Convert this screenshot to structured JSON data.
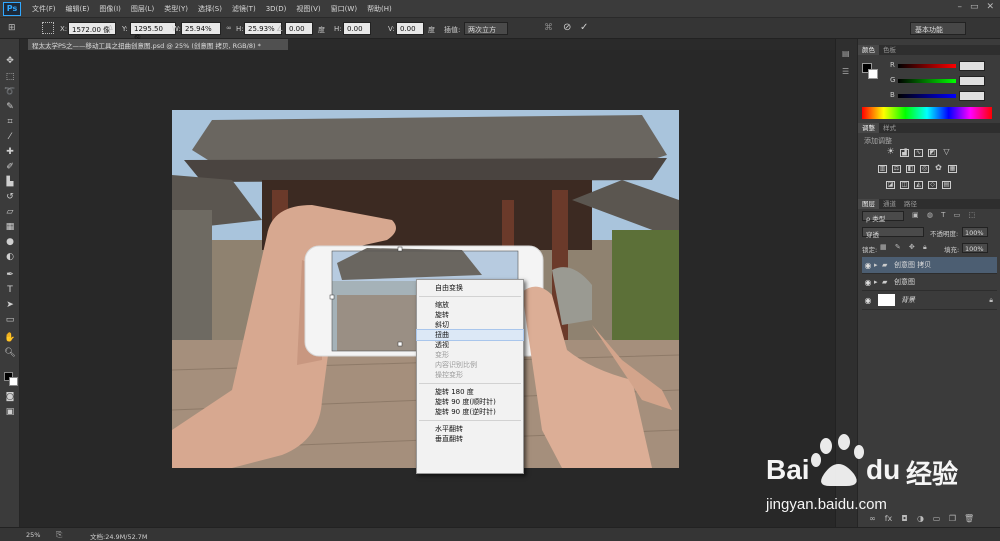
{
  "app": {
    "logo": "Ps",
    "menus": [
      "文件(F)",
      "编辑(E)",
      "图像(I)",
      "图层(L)",
      "类型(Y)",
      "选择(S)",
      "滤镜(T)",
      "3D(D)",
      "视图(V)",
      "窗口(W)",
      "帮助(H)"
    ]
  },
  "options": {
    "x_label": "X:",
    "x": "1572.00 像",
    "y_label": "Y:",
    "y": "1295.50 像",
    "w_label": "W:",
    "w": "25.94%",
    "h_label": "H:",
    "h": "25.93%",
    "angle": "0.00",
    "angle_unit": "度",
    "hskew_label": "H:",
    "hskew": "0.00",
    "vskew_label": "V:",
    "vskew": "0.00",
    "skew_unit": "度",
    "interp_label": "插值:",
    "interp": "两次立方",
    "workspace": "基本功能"
  },
  "document": {
    "tab": "程太太学PS之——移动工具之扭曲创意图.psd @ 25% (创意图 拷贝, RGB/8) *"
  },
  "context_menu": {
    "items": [
      {
        "label": "自由变换",
        "state": "normal"
      },
      {
        "sep": true
      },
      {
        "label": "缩放",
        "state": "normal"
      },
      {
        "label": "旋转",
        "state": "normal"
      },
      {
        "label": "斜切",
        "state": "normal"
      },
      {
        "label": "扭曲",
        "state": "highlight"
      },
      {
        "label": "透视",
        "state": "normal"
      },
      {
        "label": "变形",
        "state": "disabled"
      },
      {
        "label": "内容识别比例",
        "state": "disabled"
      },
      {
        "label": "操控变形",
        "state": "disabled"
      },
      {
        "sep": true
      },
      {
        "label": "旋转 180 度",
        "state": "normal"
      },
      {
        "label": "旋转 90 度(顺时针)",
        "state": "normal"
      },
      {
        "label": "旋转 90 度(逆时针)",
        "state": "normal"
      },
      {
        "sep": true
      },
      {
        "label": "水平翻转",
        "state": "normal"
      },
      {
        "label": "垂直翻转",
        "state": "normal"
      }
    ]
  },
  "panels": {
    "color_tabs": [
      "颜色",
      "色板"
    ],
    "color": {
      "r_label": "R",
      "g_label": "G",
      "b_label": "B"
    },
    "adjust_tabs": [
      "调整",
      "样式"
    ],
    "adjust_title": "添加调整",
    "layer_tabs": [
      "图层",
      "通道",
      "路径"
    ],
    "kind": "ρ 类型",
    "blend": "穿透",
    "opacity_label": "不透明度:",
    "opacity": "100%",
    "lock_label": "锁定:",
    "fill_label": "填充:",
    "fill": "100%",
    "layers": [
      {
        "name": "创意图 拷贝",
        "selected": true,
        "group": true
      },
      {
        "name": "创意图",
        "selected": false,
        "group": true
      },
      {
        "name": "背景",
        "selected": false,
        "group": false
      }
    ]
  },
  "status": {
    "zoom": "25%",
    "doc": "文档:24.9M/52.7M"
  },
  "watermark": {
    "brand": "Bai",
    "brand2": "du",
    "cn": "经验",
    "url": "jingyan.baidu.com"
  },
  "colors": {
    "accent": "#31a8ff",
    "highlight": "#4c5e72"
  }
}
